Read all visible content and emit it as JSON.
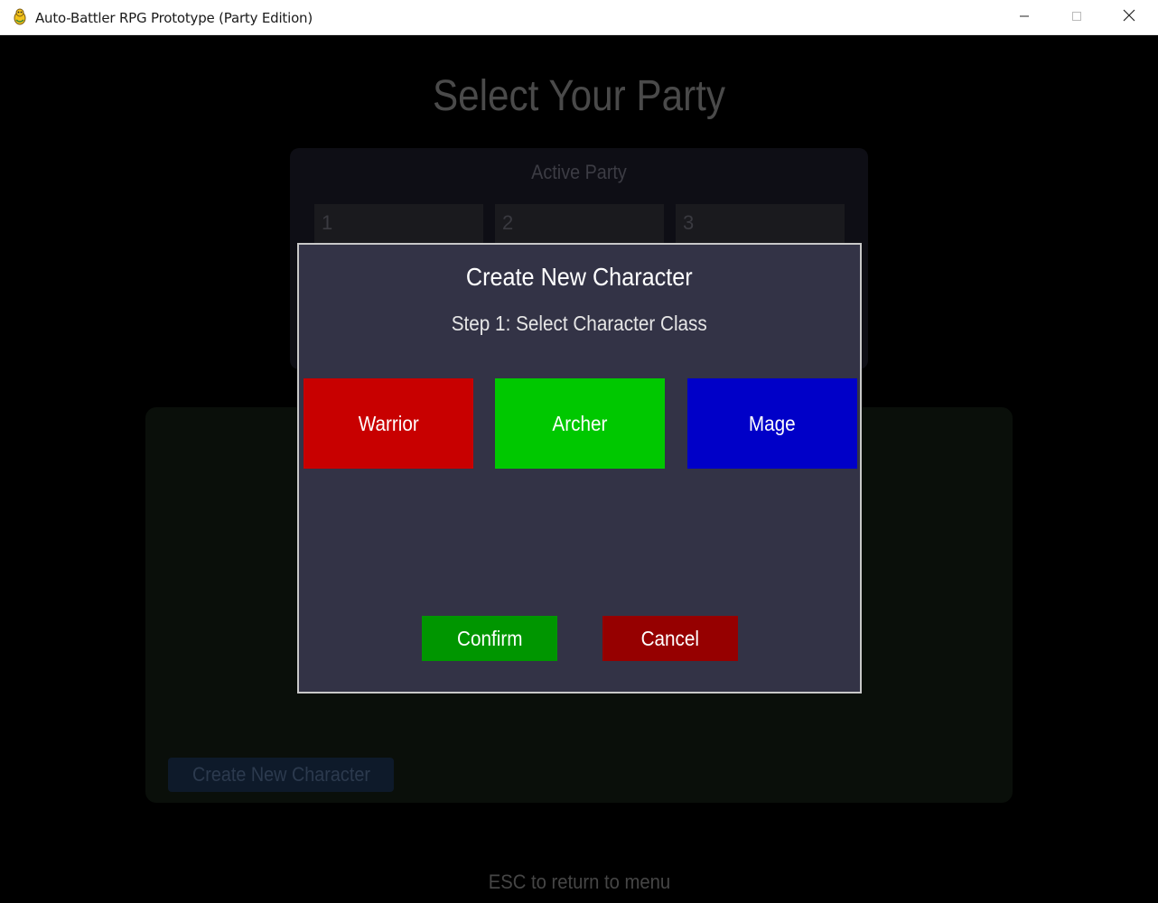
{
  "window": {
    "title": "Auto-Battler RPG Prototype (Party Edition)",
    "icon": "pygame-snake-icon",
    "controls": [
      "minimize-icon",
      "maximize-icon",
      "close-icon"
    ]
  },
  "background": {
    "title": "Select Your Party",
    "party_panel": {
      "label": "Active Party",
      "slots": [
        "1",
        "2",
        "3"
      ]
    },
    "create_button_label": "Create New Character",
    "hint": "ESC to return to menu"
  },
  "modal": {
    "title": "Create New Character",
    "step": "Step 1: Select Character Class",
    "classes": [
      {
        "label": "Warrior",
        "color": "#c80000"
      },
      {
        "label": "Archer",
        "color": "#00c800"
      },
      {
        "label": "Mage",
        "color": "#0000c8"
      }
    ],
    "confirm_label": "Confirm",
    "cancel_label": "Cancel"
  },
  "colors": {
    "modal_bg": "#333346",
    "modal_border": "#c8c8c8",
    "confirm": "#009600",
    "cancel": "#960000"
  }
}
